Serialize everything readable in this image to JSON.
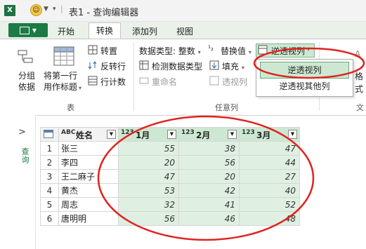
{
  "window": {
    "title": "表1 - 查询编辑器",
    "app_icon": "X",
    "smiley": "☺"
  },
  "tabs": {
    "file": "",
    "items": [
      "开始",
      "转换",
      "添加列",
      "视图"
    ],
    "active": "转换"
  },
  "ribbon": {
    "group_by": "分组\n依据",
    "first_row": "将第一行\n用作标题",
    "transpose": "转置",
    "reverse_rows": "反转行",
    "count_rows": "行计数",
    "table_group": "表",
    "data_type_label": "数据类型: 整数",
    "detect_type": "检测数据类型",
    "rename": "重命名",
    "replace_values": "替换值",
    "fill": "填充",
    "pivot_column": "透视列",
    "unpivot": "逆透视列",
    "any_column_group": "任意列",
    "right_cut_1": "A",
    "right_cut_2": "格",
    "right_cut_3": "式",
    "right_cut_4": "文"
  },
  "unpivot_menu": {
    "item1": "逆透视列",
    "item2": "逆透视其他列"
  },
  "sidebar": {
    "label": "查询"
  },
  "table": {
    "columns": [
      {
        "type": "ABC",
        "name": "姓名"
      },
      {
        "type": "123",
        "name": "1月"
      },
      {
        "type": "123",
        "name": "2月"
      },
      {
        "type": "123",
        "name": "3月"
      }
    ],
    "rows": [
      {
        "idx": "1",
        "name": "张三",
        "m1": "55",
        "m2": "38",
        "m3": "47"
      },
      {
        "idx": "2",
        "name": "李四",
        "m1": "20",
        "m2": "56",
        "m3": "44"
      },
      {
        "idx": "3",
        "name": "王二麻子",
        "m1": "47",
        "m2": "20",
        "m3": "27"
      },
      {
        "idx": "4",
        "name": "黄杰",
        "m1": "53",
        "m2": "42",
        "m3": "40"
      },
      {
        "idx": "5",
        "name": "周志",
        "m1": "32",
        "m2": "41",
        "m3": "52"
      },
      {
        "idx": "6",
        "name": "唐明明",
        "m1": "56",
        "m2": "46",
        "m3": "48"
      }
    ]
  },
  "colors": {
    "accent": "#1d7a45",
    "highlight": "#cde8d2",
    "annotation": "#e0231f"
  }
}
